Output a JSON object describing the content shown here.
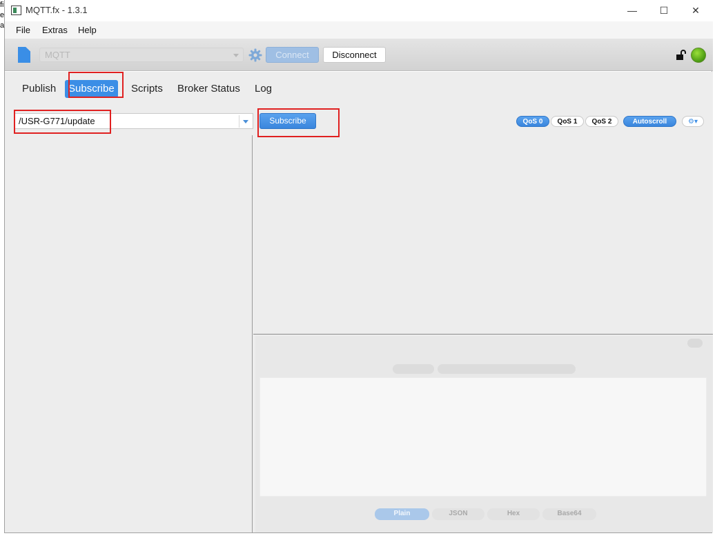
{
  "window": {
    "title": "MQTT.fx - 1.3.1",
    "controls": {
      "minimize": "—",
      "maximize": "☐",
      "close": "✕"
    }
  },
  "background_text": "fi\ne\nal",
  "menu": [
    "File",
    "Extras",
    "Help"
  ],
  "toolbar": {
    "profile_value": "MQTT",
    "connect_label": "Connect",
    "disconnect_label": "Disconnect",
    "status_color": "#4a9a12",
    "accent_color": "#3b8ee6"
  },
  "tabs": [
    {
      "label": "Publish",
      "active": false
    },
    {
      "label": "Subscribe",
      "active": true
    },
    {
      "label": "Scripts",
      "active": false
    },
    {
      "label": "Broker Status",
      "active": false
    },
    {
      "label": "Log",
      "active": false
    }
  ],
  "subscribe": {
    "topic_value": "/USR-G771/update",
    "button_label": "Subscribe",
    "qos": [
      {
        "label": "QoS 0",
        "selected": true
      },
      {
        "label": "QoS 1",
        "selected": false
      },
      {
        "label": "QoS 2",
        "selected": false
      }
    ],
    "autoscroll_label": "Autoscroll",
    "autoscroll_on": true
  },
  "payload_formats": [
    {
      "label": "Plain",
      "selected": true
    },
    {
      "label": "JSON",
      "selected": false
    },
    {
      "label": "Hex",
      "selected": false
    },
    {
      "label": "Base64",
      "selected": false
    }
  ]
}
